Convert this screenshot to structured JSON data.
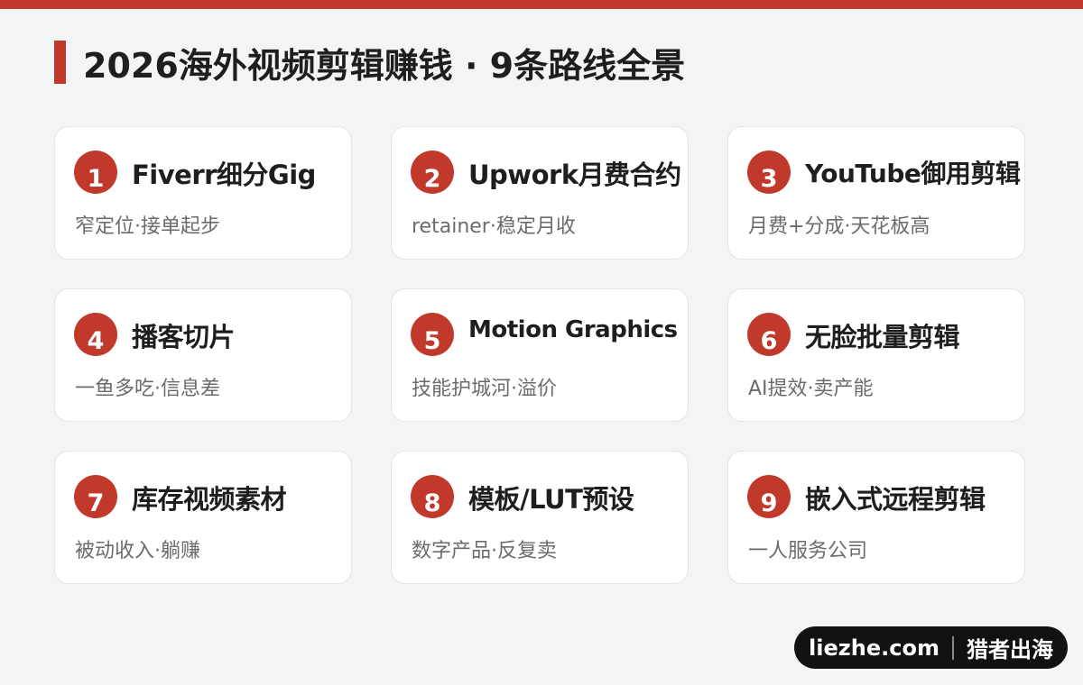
{
  "title": "2026海外视频剪辑赚钱 · 9条路线全景",
  "colors": {
    "accent": "#c0392b",
    "background": "#f3f4f6",
    "card": "#ffffff"
  },
  "cards": [
    {
      "num": "1",
      "title": "Fiverr细分Gig",
      "sub": "窄定位·接单起步"
    },
    {
      "num": "2",
      "title": "Upwork月费合约",
      "sub": "retainer·稳定月收"
    },
    {
      "num": "3",
      "title": "YouTube御用剪辑",
      "sub": "月费+分成·天花板高"
    },
    {
      "num": "4",
      "title": "播客切片",
      "sub": "一鱼多吃·信息差"
    },
    {
      "num": "5",
      "title": "Motion Graphics",
      "sub": "技能护城河·溢价"
    },
    {
      "num": "6",
      "title": "无脸批量剪辑",
      "sub": "AI提效·卖产能"
    },
    {
      "num": "7",
      "title": "库存视频素材",
      "sub": "被动收入·躺赚"
    },
    {
      "num": "8",
      "title": "模板/LUT预设",
      "sub": "数字产品·反复卖"
    },
    {
      "num": "9",
      "title": "嵌入式远程剪辑",
      "sub": "一人服务公司"
    }
  ],
  "brand": {
    "site": "liezhe.com",
    "name": "猎者出海"
  }
}
